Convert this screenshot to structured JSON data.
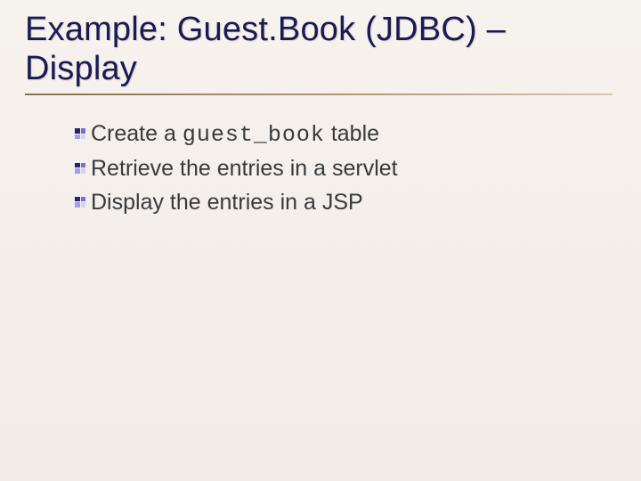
{
  "title_line1": "Example: Guest.Book (JDBC) –",
  "title_line2": "Display",
  "bullets": [
    {
      "pre": "Create a ",
      "code": "guest_book",
      "post": " table"
    },
    {
      "pre": "Retrieve the entries in a servlet",
      "code": "",
      "post": ""
    },
    {
      "pre": "Display the entries in a JSP",
      "code": "",
      "post": ""
    }
  ]
}
